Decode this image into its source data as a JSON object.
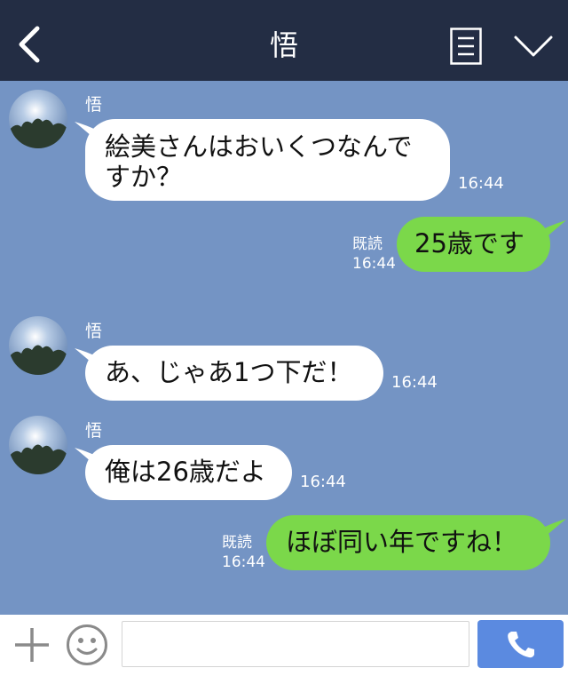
{
  "header": {
    "title": "悟"
  },
  "messages": [
    {
      "direction": "in",
      "sender": "悟",
      "lines": [
        "絵美さんはおいくつなんで",
        "すか？"
      ],
      "time": "16:44"
    },
    {
      "direction": "out",
      "read": "既読",
      "text": "25歳です",
      "time": "16:44"
    },
    {
      "direction": "in",
      "sender": "悟",
      "text": "あ、じゃあ1つ下だ！",
      "time": "16:44"
    },
    {
      "direction": "in",
      "sender": "悟",
      "text": "俺は26歳だよ",
      "time": "16:44"
    },
    {
      "direction": "out",
      "read": "既読",
      "text": "ほぼ同い年ですね！",
      "time": "16:44"
    }
  ],
  "input": {
    "placeholder": ""
  },
  "colors": {
    "header_bg": "#232d44",
    "chat_bg": "#7494c4",
    "outgoing_bubble": "#7bd84a",
    "incoming_bubble": "#ffffff",
    "call_button": "#5b8ae0"
  },
  "icons": [
    "back-icon",
    "menu-icon",
    "chevron-down-icon",
    "plus-icon",
    "smile-icon",
    "phone-icon"
  ]
}
